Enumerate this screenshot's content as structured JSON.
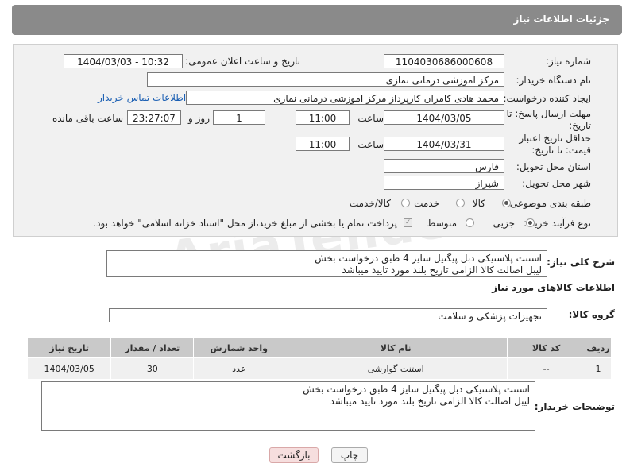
{
  "header": {
    "title": "جزئیات اطلاعات نیاز"
  },
  "form": {
    "need_number_label": "شماره نیاز:",
    "need_number": "1104030686000608",
    "announce_label": "تاریخ و ساعت اعلان عمومی:",
    "announce_value": "1404/03/03 - 10:32",
    "buyer_org_label": "نام دستگاه خریدار:",
    "buyer_org": "مرکز اموزشی درمانی نمازی",
    "creator_label": "ایجاد کننده درخواست:",
    "creator": "محمد هادی کامران کارپرداز مرکز اموزشی درمانی نمازی",
    "contact_link": "اطلاعات تماس خریدار",
    "deadline_label": "مهلت ارسال پاسخ: تا تاریخ:",
    "deadline_date": "1404/03/05",
    "time_label": "ساعت",
    "deadline_time": "11:00",
    "days_value": "1",
    "days_label": "روز و",
    "remaining_time": "23:27:07",
    "remaining_label": "ساعت باقی مانده",
    "validity_label": "حداقل تاریخ اعتبار قیمت: تا تاریخ:",
    "validity_date": "1404/03/31",
    "validity_time": "11:00",
    "province_label": "استان محل تحویل:",
    "province": "فارس",
    "city_label": "شهر محل تحویل:",
    "city": "شیراز",
    "category_label": "طبقه بندی موضوعی:",
    "category_options": [
      "کالا",
      "خدمت",
      "کالا/خدمت"
    ],
    "process_label": "نوع فرآیند خرید :",
    "process_options": [
      "جزیی",
      "متوسط"
    ],
    "payment_note": "پرداخت تمام یا بخشی از مبلغ خرید،از محل \"اسناد خزانه اسلامی\" خواهد بود."
  },
  "description": {
    "label": "شرح کلی نیاز:",
    "line1": "استنت پلاستیکی دبل پیگتیل سایز 4 طبق درخواست بخش",
    "line2": "لیبل اصالت کالا الزامی تاریخ بلند مورد تایید میباشد"
  },
  "goods_section": {
    "title": "اطلاعات کالاهای مورد نیاز",
    "group_label": "گروه کالا:",
    "group_value": "تجهیزات پزشکی و سلامت"
  },
  "table": {
    "headers": [
      "ردیف",
      "کد کالا",
      "نام کالا",
      "واحد شمارش",
      "تعداد / مقدار",
      "تاریخ نیاز"
    ],
    "rows": [
      [
        "1",
        "--",
        "استنت گوارشی",
        "عدد",
        "30",
        "1404/03/05"
      ]
    ]
  },
  "buyer_notes": {
    "label": "توضیحات خریدار:",
    "line1": "استنت پلاستیکی دبل پیگتیل سایز 4 طبق درخواست بخش",
    "line2": "لیبل اصالت کالا الزامی تاریخ بلند مورد تایید میباشد"
  },
  "buttons": {
    "print": "چاپ",
    "back": "بازگشت"
  },
  "watermark": "AriaTender.neT"
}
